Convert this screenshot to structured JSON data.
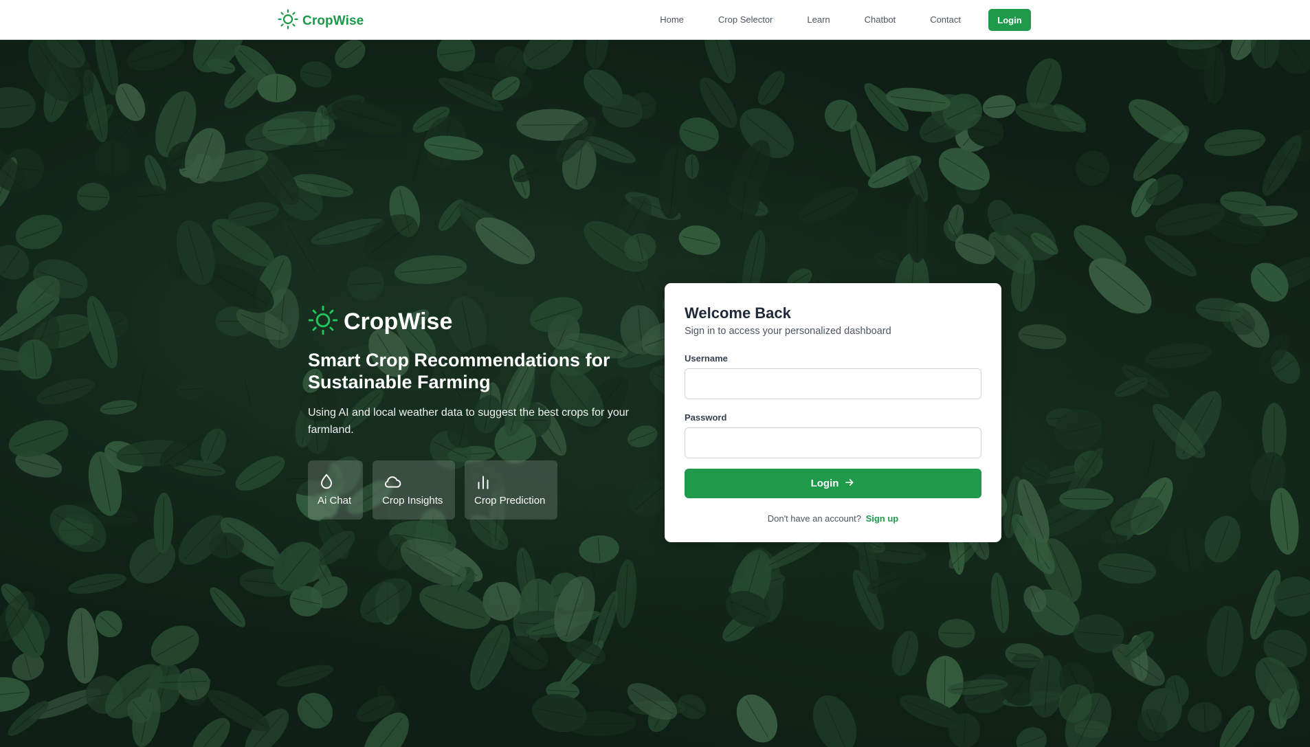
{
  "nav": {
    "brand": "CropWise",
    "links": [
      "Home",
      "Crop Selector",
      "Learn",
      "Chatbot",
      "Contact"
    ],
    "login": "Login"
  },
  "intro": {
    "brand": "CropWise",
    "headline": "Smart Crop Recommendations for Sustainable Farming",
    "subtitle": "Using AI and local weather data to suggest the best crops for your farmland.",
    "features": [
      {
        "label": "Ai Chat",
        "icon": "droplet-icon"
      },
      {
        "label": "Crop Insights",
        "icon": "cloud-icon"
      },
      {
        "label": "Crop Prediction",
        "icon": "bar-chart-icon"
      }
    ]
  },
  "login_card": {
    "title": "Welcome Back",
    "subtitle": "Sign in to access your personalized dashboard",
    "username_label": "Username",
    "username_value": "",
    "password_label": "Password",
    "password_value": "",
    "submit": "Login",
    "signup_prompt": "Don't have an account?",
    "signup_link": "Sign up"
  },
  "colors": {
    "brand_green": "#1f9a4a",
    "brand_icon": "#22c55e",
    "hero_bg": "#12261a"
  }
}
